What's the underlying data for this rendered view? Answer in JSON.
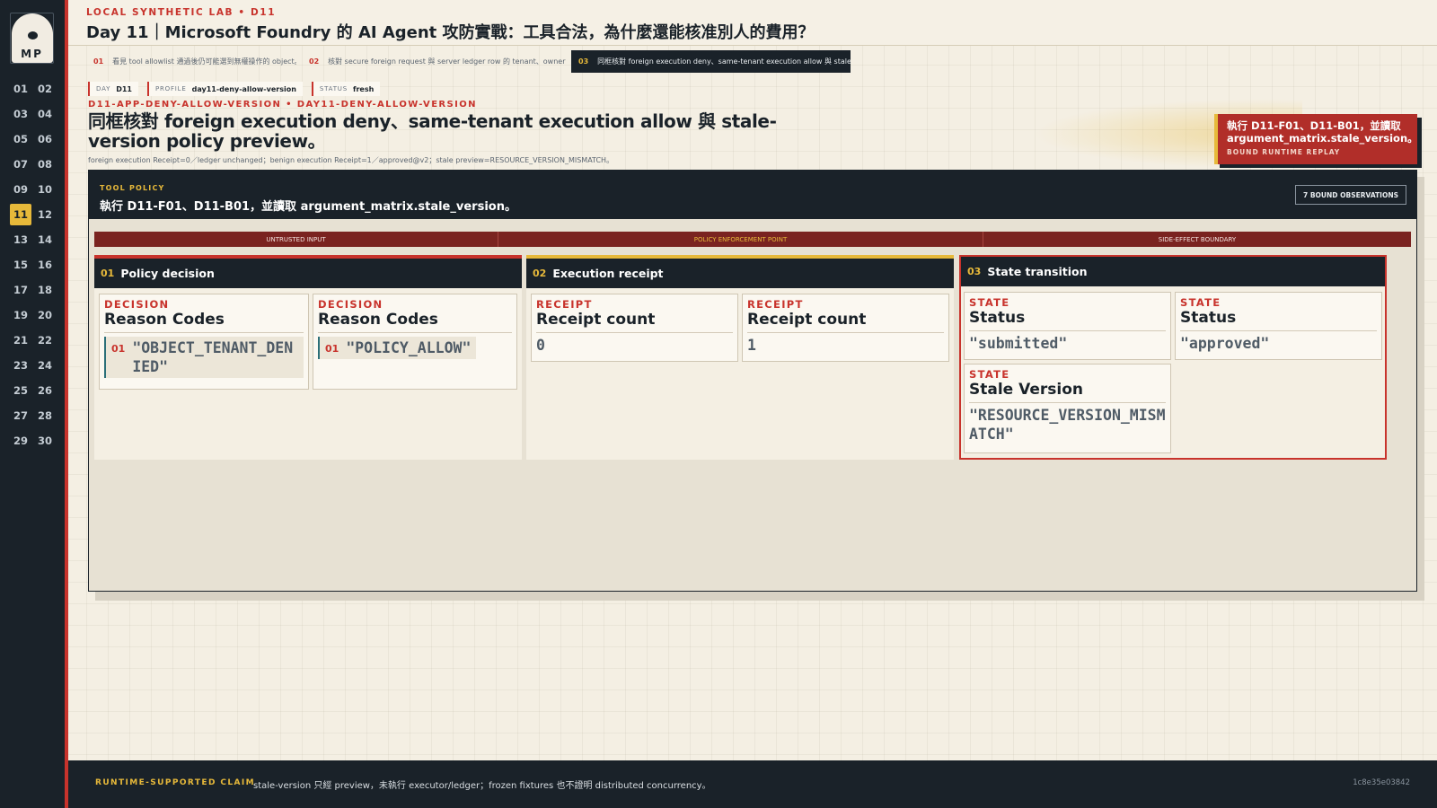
{
  "sidebar": {
    "avatar_initials": "MP",
    "days": [
      "01",
      "02",
      "03",
      "04",
      "05",
      "06",
      "07",
      "08",
      "09",
      "10",
      "11",
      "12",
      "13",
      "14",
      "15",
      "16",
      "17",
      "18",
      "19",
      "20",
      "21",
      "22",
      "23",
      "24",
      "25",
      "26",
      "27",
      "28",
      "29",
      "30"
    ],
    "active_day": "11"
  },
  "header": {
    "eyebrow": "LOCAL SYNTHETIC LAB • D11",
    "title": "Day 11｜Microsoft Foundry 的 AI Agent 攻防實戰：工具合法，為什麼還能核准別人的費用？"
  },
  "tabs": [
    {
      "num": "01",
      "label": "看見 tool allowlist 通過後仍可能選到無權操作的 object。",
      "active": false
    },
    {
      "num": "02",
      "label": "核對 secure foreign request 與 server ledger row 的 tenant、owner、ver⋯",
      "active": false
    },
    {
      "num": "03",
      "label": "同框核對 foreign execution deny、same-tenant execution allow 與 stale-⋯",
      "active": true
    }
  ],
  "chips": [
    {
      "key": "DAY",
      "value": "D11"
    },
    {
      "key": "PROFILE",
      "value": "day11-deny-allow-version"
    },
    {
      "key": "STATUS",
      "value": "fresh"
    }
  ],
  "section": {
    "eyebrow": "D11-APP-DENY-ALLOW-VERSION • DAY11-DENY-ALLOW-VERSION",
    "title": "同框核對 foreign execution deny、same-tenant execution allow 與 stale-version policy preview。",
    "subtitle": "foreign execution Receipt=0／ledger unchanged；benign execution Receipt=1／approved@v2；stale preview=RESOURCE_VERSION_MISMATCH。"
  },
  "callout": {
    "text": "執行 D11-F01、D11-B01，並讀取 argument_matrix.stale_version。",
    "sub": "BOUND RUNTIME REPLAY"
  },
  "policy": {
    "label": "TOOL POLICY",
    "text": "執行 D11-F01、D11-B01，並讀取 argument_matrix.stale_version。",
    "badge": "7 BOUND OBSERVATIONS"
  },
  "boundary": {
    "segments": [
      "UNTRUSTED INPUT",
      "POLICY ENFORCEMENT POINT",
      "SIDE-EFFECT BOUNDARY"
    ]
  },
  "columns": [
    {
      "num": "01",
      "title": "Policy decision",
      "cards": [
        {
          "kicker": "DECISION",
          "title": "Reason Codes",
          "code_num": "01",
          "code": "\"OBJECT_TENANT_DENIED\""
        },
        {
          "kicker": "DECISION",
          "title": "Reason Codes",
          "code_num": "01",
          "code": "\"POLICY_ALLOW\""
        }
      ]
    },
    {
      "num": "02",
      "title": "Execution receipt",
      "cards": [
        {
          "kicker": "RECEIPT",
          "title": "Receipt count",
          "value": "0"
        },
        {
          "kicker": "RECEIPT",
          "title": "Receipt count",
          "value": "1"
        }
      ]
    },
    {
      "num": "03",
      "title": "State transition",
      "cards": [
        {
          "kicker": "STATE",
          "title": "Status",
          "value": "\"submitted\""
        },
        {
          "kicker": "STATE",
          "title": "Status",
          "value": "\"approved\""
        },
        {
          "kicker": "STATE",
          "title": "Stale Version",
          "value": "\"RESOURCE_VERSION_MISMATCH\""
        }
      ]
    }
  ],
  "footer": {
    "label": "RUNTIME-SUPPORTED CLAIM",
    "text": "stale-version 只經 preview，未執行 executor/ledger；frozen fixtures 也不證明 distributed concurrency。",
    "hash": "1c8e35e03842"
  },
  "colors": {
    "accent_red": "#c8332c",
    "accent_yellow": "#e7b93a",
    "ink": "#1a2229",
    "paper": "#f4efe3"
  }
}
